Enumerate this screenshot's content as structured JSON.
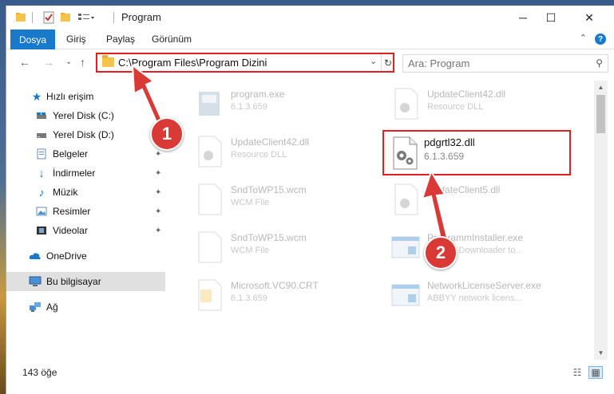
{
  "window": {
    "title": "Program",
    "minimize": "─",
    "maximize": "☐",
    "close": "✕"
  },
  "ribbon": {
    "file_tab": "Dosya",
    "tabs": [
      "Giriş",
      "Paylaş",
      "Görünüm"
    ],
    "help": "?",
    "collapse": "⌃"
  },
  "nav": {
    "back": "←",
    "forward": "→",
    "recent": "⌄",
    "up": "↑",
    "address": "C:\\Program Files\\Program Dizini",
    "address_dropdown": "⌄",
    "refresh": "↻",
    "search_placeholder": "Ara: Program",
    "search_icon": "⚲"
  },
  "sidebar": {
    "items": [
      {
        "label": "Hızlı erişim",
        "icon": "star-icon",
        "pinned": false
      },
      {
        "label": "Yerel Disk (C:)",
        "icon": "drive-icon",
        "pinned": false
      },
      {
        "label": "Yerel Disk (D:)",
        "icon": "drive-icon",
        "pinned": false
      },
      {
        "label": "Belgeler",
        "icon": "documents-icon",
        "pinned": true
      },
      {
        "label": "İndirmeler",
        "icon": "download-icon",
        "pinned": true
      },
      {
        "label": "Müzik",
        "icon": "music-icon",
        "pinned": true
      },
      {
        "label": "Resimler",
        "icon": "pictures-icon",
        "pinned": true
      },
      {
        "label": "Videolar",
        "icon": "videos-icon",
        "pinned": true
      },
      {
        "label": "OneDrive",
        "icon": "cloud-icon",
        "pinned": false
      },
      {
        "label": "Bu bilgisayar",
        "icon": "computer-icon",
        "pinned": false
      },
      {
        "label": "Ağ",
        "icon": "network-icon",
        "pinned": false
      }
    ],
    "pin_glyph": "📌"
  },
  "files": [
    {
      "name": "program.exe",
      "desc": "6.1.3.659",
      "icon": "exe-icon"
    },
    {
      "name": "UpdateClient42.dll",
      "desc": "Resource DLL",
      "icon": "dll-icon"
    },
    {
      "name": "UpdateClient42.dll",
      "desc": "Resource DLL",
      "icon": "dll-icon"
    },
    {
      "name": "SndToWP15.wcm",
      "desc": "WCM File",
      "icon": "file-icon"
    },
    {
      "name": "UpdateClient5.dll",
      "desc": "",
      "icon": "dll-icon"
    },
    {
      "name": "SndToWP15.wcm",
      "desc": "WCM File",
      "icon": "file-icon"
    },
    {
      "name": "ProgrammInstaller.exe",
      "desc": "ABBYY Downloader to...",
      "icon": "installer-icon"
    },
    {
      "name": "Microsoft.VC90.CRT",
      "desc": "6.1.3.659",
      "icon": "folder-file-icon"
    },
    {
      "name": "NetworkLicenseServer.exe",
      "desc": "ABBYY network licens...",
      "icon": "installer-icon"
    }
  ],
  "highlighted_file": {
    "name": "pdgrtl32.dll",
    "desc": "6.1.3.659",
    "icon": "dll-gear-icon"
  },
  "status": {
    "count": "143 öğe",
    "details_view": "☷",
    "tiles_view": "▦"
  },
  "annotations": {
    "step1": "1",
    "step2": "2",
    "color": "#d93a36"
  }
}
